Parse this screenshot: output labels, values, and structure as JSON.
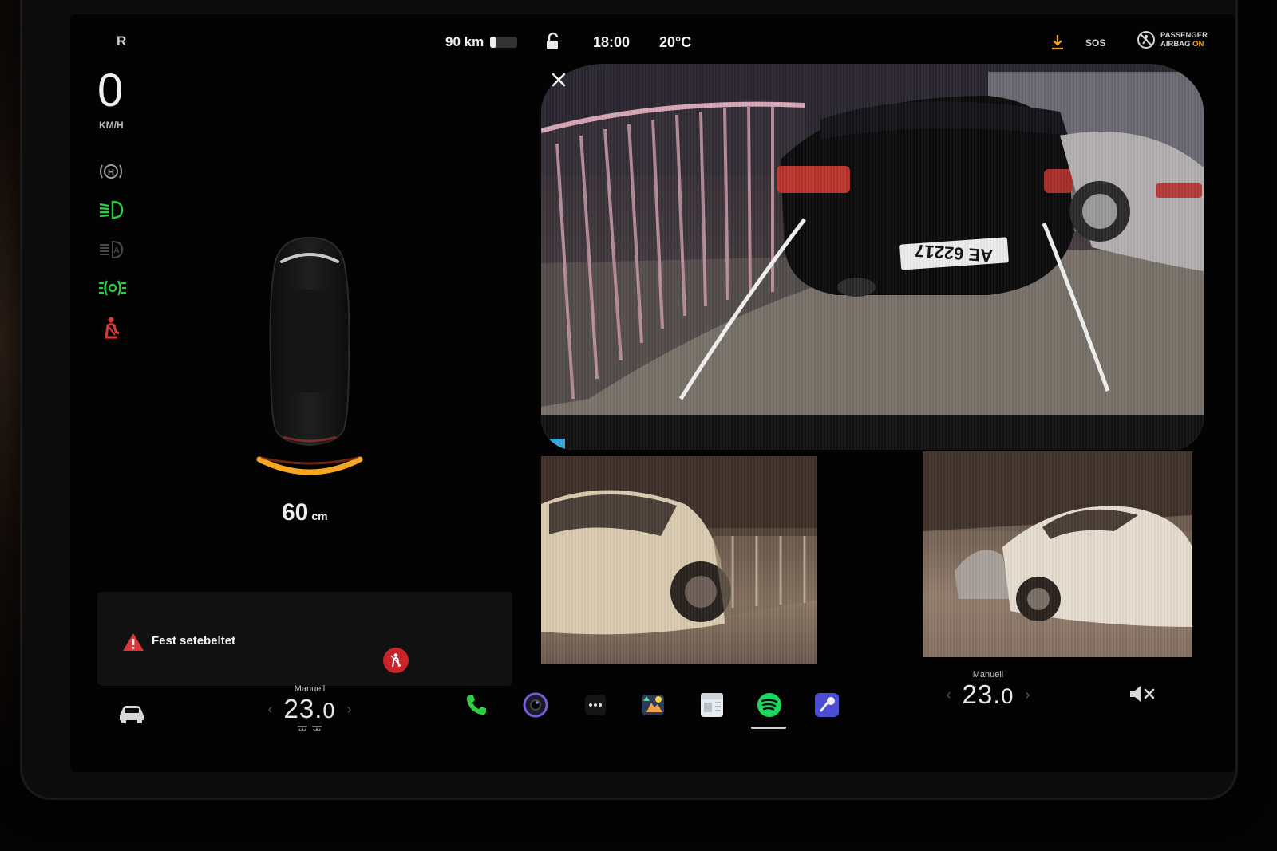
{
  "status_bar": {
    "gear": "R",
    "range": "90 km",
    "battery_level": 0.2,
    "time": "18:00",
    "outside_temp": "20°C",
    "sos_label": "SOS",
    "airbag_line1": "PASSENGER",
    "airbag_line2_prefix": "AIRBAG",
    "airbag_line2_state": "ON"
  },
  "drive": {
    "speed": "0",
    "speed_unit": "KM/H",
    "telltales": [
      "auto-hold-icon",
      "low-beam-icon",
      "auto-high-beam-icon",
      "parking-lights-icon",
      "seatbelt-warning-icon"
    ]
  },
  "parking": {
    "distance_value": "60",
    "distance_unit": "cm"
  },
  "notification": {
    "text": "Fest setebeltet"
  },
  "climate": {
    "driver": {
      "mode": "Manuell",
      "temp_int": "23.",
      "temp_dec": "0"
    },
    "passenger": {
      "mode": "Manuell",
      "temp_int": "23.",
      "temp_dec": "0"
    }
  },
  "camera": {
    "plate_text": "AE 62217"
  },
  "dock": {
    "apps": [
      "phone-icon",
      "camera-app-icon",
      "more-apps-icon",
      "arcade-icon",
      "calendar-icon",
      "spotify-icon",
      "karaoke-icon"
    ],
    "active_app": "spotify-icon"
  },
  "colors": {
    "accent_green": "#2ecc40",
    "warning_red": "#d93838",
    "orange": "#f5a623",
    "spotify": "#1ed760"
  }
}
